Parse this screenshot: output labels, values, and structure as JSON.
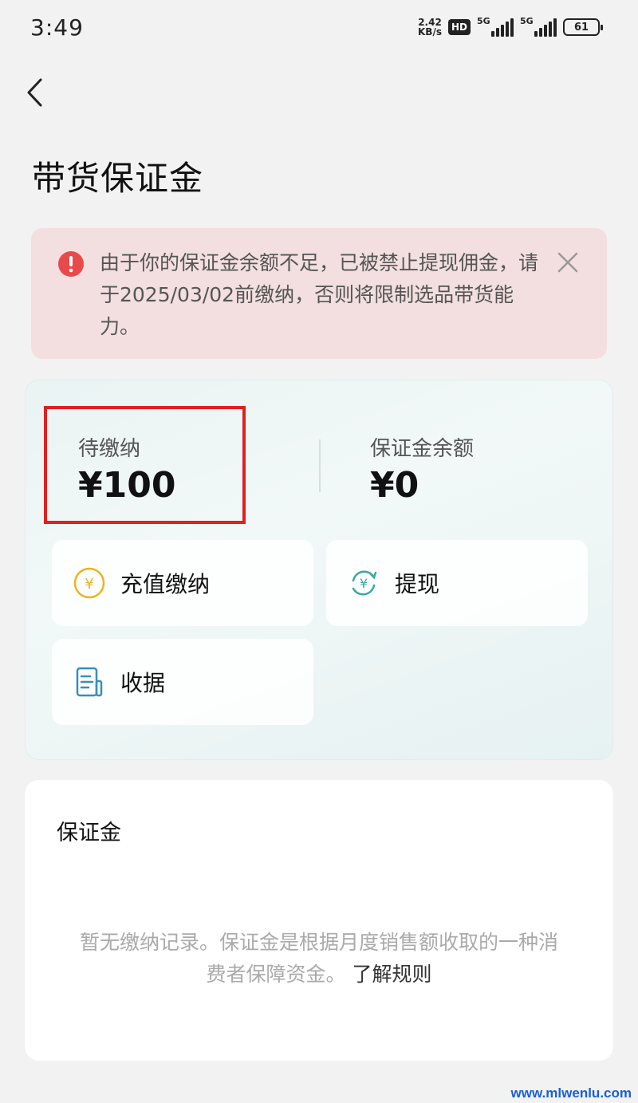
{
  "status_bar": {
    "time": "3:49",
    "net_speed_value": "2.42",
    "net_speed_unit": "KB/s",
    "hd_label": "HD",
    "signal_1_label": "5G",
    "signal_2_label": "5G",
    "battery": "61"
  },
  "header": {
    "back_icon": "chevron-left-icon",
    "title": "带货保证金"
  },
  "alert": {
    "icon": "exclamation-circle-icon",
    "color": "#e84a4a",
    "message": "由于你的保证金余额不足，已被禁止提现佣金，请于2025/03/02前缴纳，否则将限制选品带货能力。",
    "close_icon": "close-icon"
  },
  "balance": {
    "pending_label": "待缴纳",
    "pending_value": "¥100",
    "balance_label": "保证金余额",
    "balance_value": "¥0",
    "highlight_color": "#e0201e"
  },
  "actions": {
    "recharge": {
      "label": "充值缴纳",
      "icon": "yuan-coin-icon"
    },
    "withdraw": {
      "label": "提现",
      "icon": "yuan-refresh-icon"
    },
    "receipt": {
      "label": "收据",
      "icon": "receipt-icon"
    }
  },
  "records": {
    "title": "保证金",
    "empty_text": "暂无缴纳记录。保证金是根据月度销售额收取的一种消费者保障资金。",
    "link_text": "了解规则"
  },
  "watermark": "www.mlwenlu.com"
}
